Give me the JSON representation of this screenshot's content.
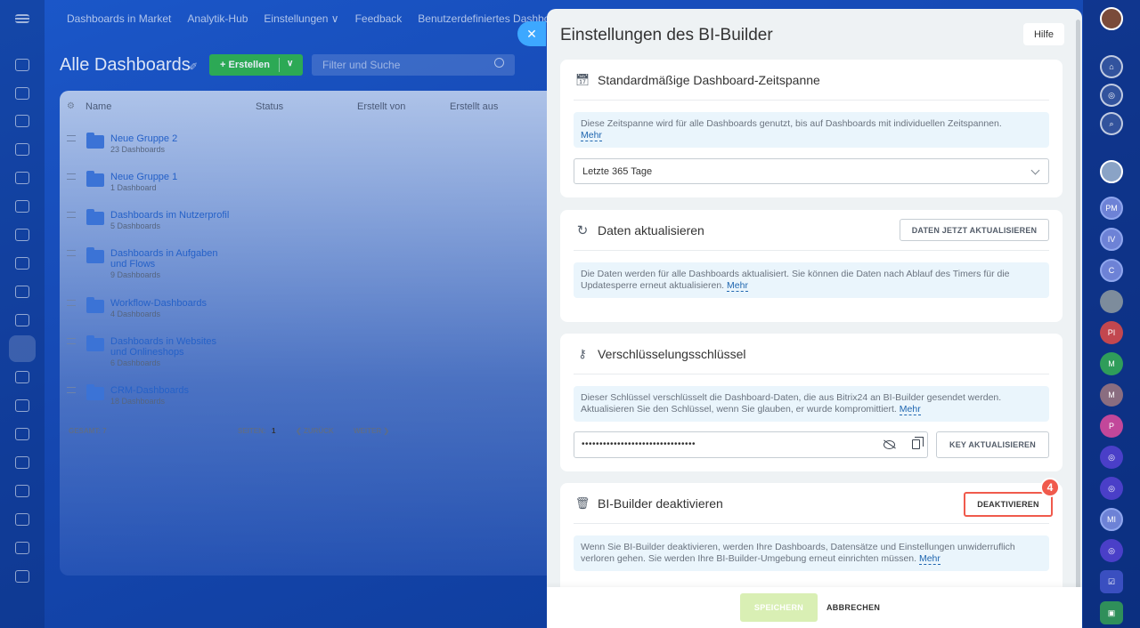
{
  "topnav": [
    "Dashboards in Market",
    "Analytik-Hub",
    "Einstellungen ∨",
    "Feedback",
    "Benutzerdefiniertes Dashbo"
  ],
  "page": {
    "title": "Alle Dashboards",
    "create_label": "+ Erstellen",
    "search_placeholder": "Filter und Suche"
  },
  "grid": {
    "columns": [
      "Name",
      "Status",
      "Erstellt von",
      "Erstellt aus"
    ],
    "rows": [
      {
        "name": "Neue Gruppe 2",
        "count": "23 Dashboards"
      },
      {
        "name": "Neue Gruppe 1",
        "count": "1 Dashboard"
      },
      {
        "name": "Dashboards im Nutzerprofil",
        "count": "5 Dashboards"
      },
      {
        "name": "Dashboards in Aufgaben und Flows",
        "count": "9 Dashboards"
      },
      {
        "name": "Workflow-Dashboards",
        "count": "4 Dashboards"
      },
      {
        "name": "Dashboards in Websites und Onlineshops",
        "count": "6 Dashboards"
      },
      {
        "name": "CRM-Dashboards",
        "count": "18 Dashboards"
      }
    ],
    "total_label": "GESAMT: 7",
    "pages_label": "SEITEN:",
    "page_number": "1",
    "prev_label": "❮ ZURÜCK",
    "next_label": "WEITER ❯"
  },
  "right_rail": {
    "avatars": [
      "PM",
      "IV",
      "C",
      "PI",
      "M",
      "M",
      "P",
      "MI"
    ]
  },
  "slider": {
    "title": "Einstellungen des BI-Builder",
    "help_label": "Hilfe",
    "close_icon": "✕",
    "sections": {
      "period": {
        "title": "Standardmäßige Dashboard-Zeitspanne",
        "info": "Diese Zeitspanne wird für alle Dashboards genutzt, bis auf Dashboards mit individuellen Zeitspannen.",
        "more": "Mehr",
        "select_value": "Letzte 365 Tage"
      },
      "refresh": {
        "title": "Daten aktualisieren",
        "button": "DATEN JETZT AKTUALISIEREN",
        "info": "Die Daten werden für alle Dashboards aktualisiert. Sie können die Daten nach Ablauf des Timers für die Updatesperre erneut aktualisieren.",
        "more": "Mehr"
      },
      "key": {
        "title": "Verschlüsselungsschlüssel",
        "info": "Dieser Schlüssel verschlüsselt die Dashboard-Daten, die aus Bitrix24 an BI-Builder gesendet werden. Aktualisieren Sie den Schlüssel, wenn Sie glauben, er wurde kompromittiert.",
        "more": "Mehr",
        "key_value": "••••••••••••••••••••••••••••••••",
        "button": "KEY AKTUALISIEREN"
      },
      "deactivate": {
        "title": "BI-Builder deaktivieren",
        "button": "DEAKTIVIEREN",
        "step_badge": "4",
        "info": "Wenn Sie BI-Builder deaktivieren, werden Ihre Dashboards, Datensätze und Einstellungen unwiderruflich verloren gehen. Sie werden Ihre BI-Builder-Umgebung erneut einrichten müssen.",
        "more": "Mehr"
      }
    },
    "footer": {
      "save": "SPEICHERN",
      "cancel": "ABBRECHEN"
    }
  },
  "colors": {
    "accent": "#2067b0",
    "highlight": "#f05a4c",
    "save_disabled": "#d9efb4"
  }
}
